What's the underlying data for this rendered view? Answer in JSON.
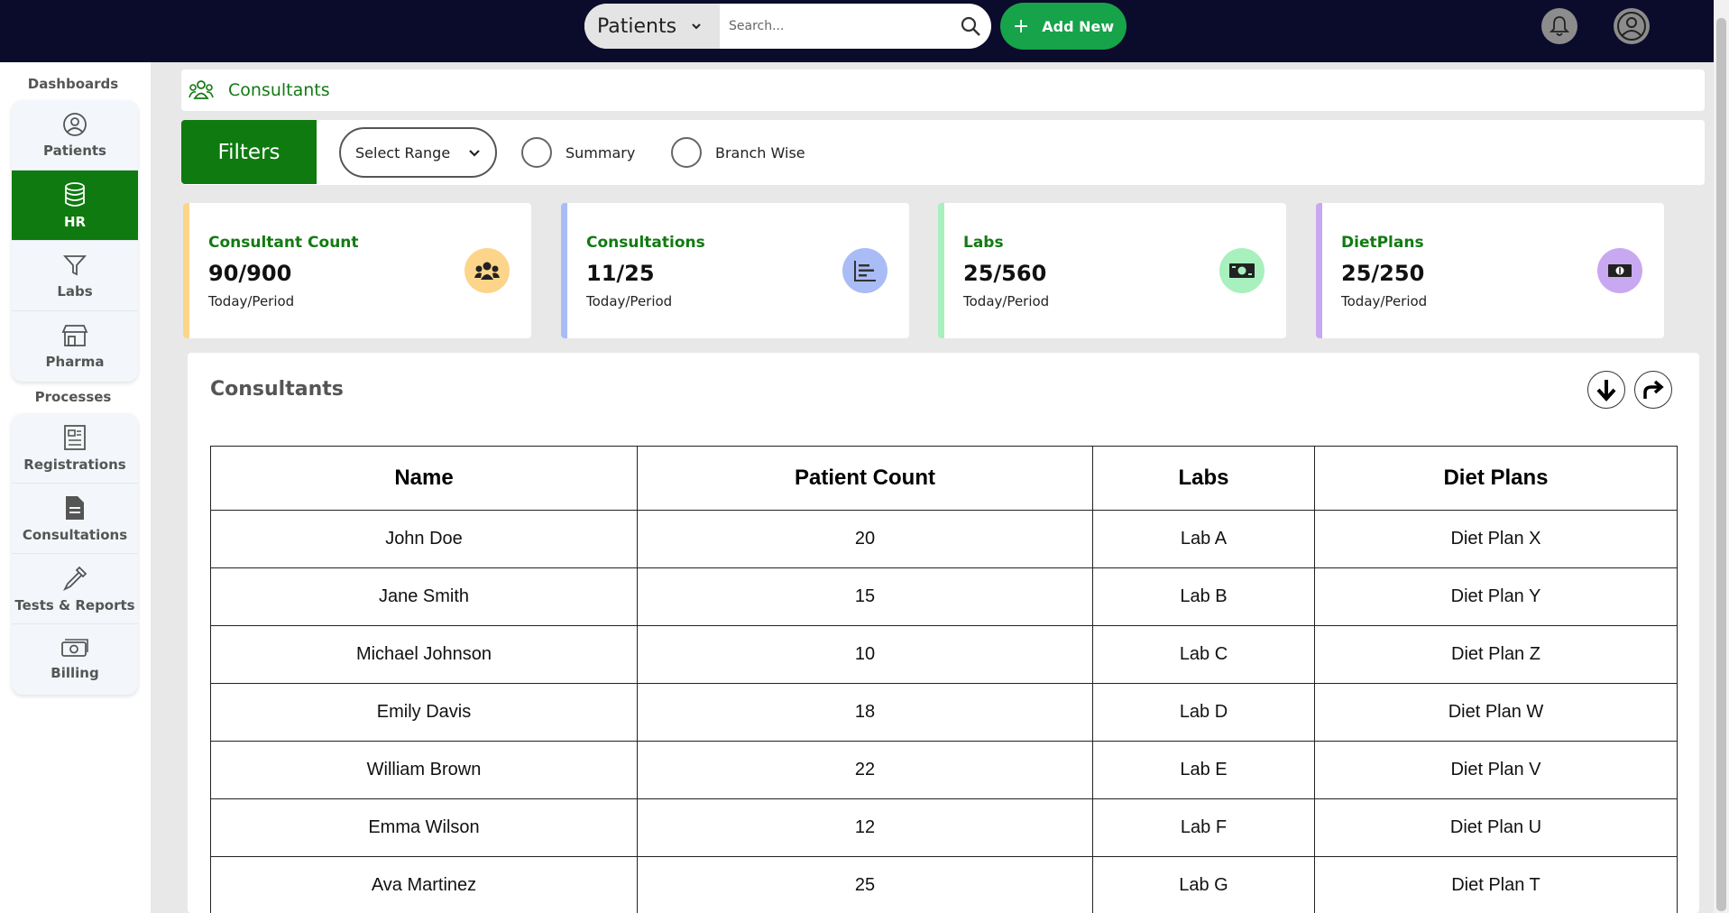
{
  "header": {
    "search_scope": "Patients",
    "search_placeholder": "Search...",
    "add_new_label": "Add New"
  },
  "sidebar": {
    "dashboards_title": "Dashboards",
    "dashboards": [
      {
        "label": "Patients",
        "icon": "user-circle-icon"
      },
      {
        "label": "HR",
        "icon": "database-icon",
        "active": true
      },
      {
        "label": "Labs",
        "icon": "filter-icon"
      },
      {
        "label": "Pharma",
        "icon": "store-icon"
      }
    ],
    "processes_title": "Processes",
    "processes": [
      {
        "label": "Registrations",
        "icon": "newspaper-icon"
      },
      {
        "label": "Consultations",
        "icon": "document-icon"
      },
      {
        "label": "Tests & Reports",
        "icon": "pipette-icon"
      },
      {
        "label": "Billing",
        "icon": "money-icon"
      }
    ]
  },
  "breadcrumb": {
    "label": "Consultants"
  },
  "filters": {
    "label": "Filters",
    "range_label": "Select Range",
    "options": [
      "Summary",
      "Branch Wise"
    ]
  },
  "cards": [
    {
      "title": "Consultant Count",
      "value": "90/900",
      "sub": "Today/Period",
      "accent": "#fdd58a",
      "icon": "users-icon"
    },
    {
      "title": "Consultations",
      "value": "11/25",
      "sub": "Today/Period",
      "accent": "#a9bcf5",
      "icon": "bar-chart-icon"
    },
    {
      "title": "Labs",
      "value": "25/560",
      "sub": "Today/Period",
      "accent": "#a8f0bd",
      "icon": "money-bill-icon"
    },
    {
      "title": "DietPlans",
      "value": "25/250",
      "sub": "Today/Period",
      "accent": "#c9a8f2",
      "icon": "dollar-bill-icon"
    }
  ],
  "table": {
    "title": "Consultants",
    "columns": [
      "Name",
      "Patient Count",
      "Labs",
      "Diet Plans"
    ],
    "rows": [
      [
        "John Doe",
        "20",
        "Lab A",
        "Diet Plan X"
      ],
      [
        "Jane Smith",
        "15",
        "Lab B",
        "Diet Plan Y"
      ],
      [
        "Michael Johnson",
        "10",
        "Lab C",
        "Diet Plan Z"
      ],
      [
        "Emily Davis",
        "18",
        "Lab D",
        "Diet Plan W"
      ],
      [
        "William Brown",
        "22",
        "Lab E",
        "Diet Plan V"
      ],
      [
        "Emma Wilson",
        "12",
        "Lab F",
        "Diet Plan U"
      ],
      [
        "Ava Martinez",
        "25",
        "Lab G",
        "Diet Plan T"
      ]
    ]
  },
  "colors": {
    "brand_green": "#0f7a0f",
    "topbar": "#0b0b2b",
    "add_button": "#16a34a"
  }
}
